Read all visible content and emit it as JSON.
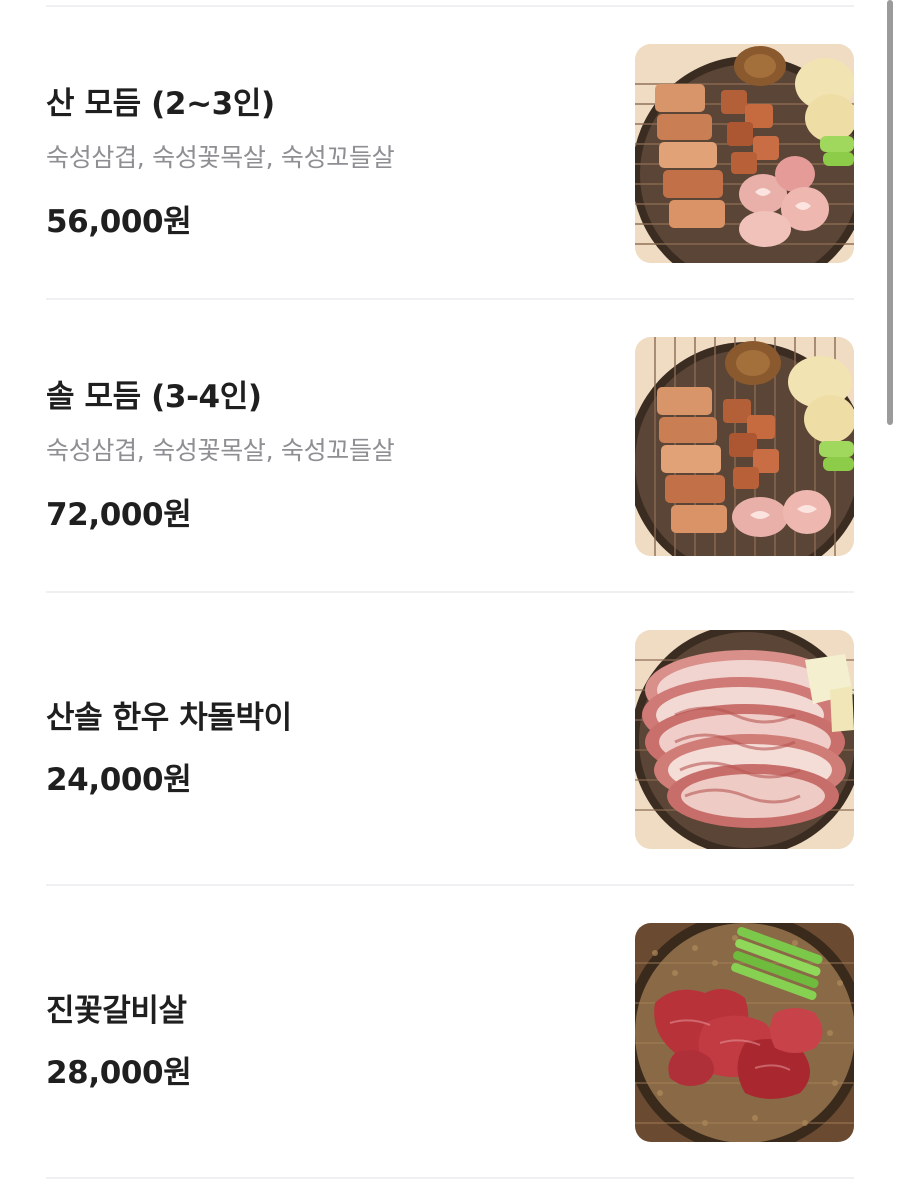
{
  "menu": {
    "items": [
      {
        "name": "산 모듬 (2~3인)",
        "description": "숙성삼겹, 숙성꽃목살, 숙성꼬들살",
        "price": "56,000원",
        "image": "assorted-pork-platter-photo"
      },
      {
        "name": "솔 모듬 (3-4인)",
        "description": "숙성삼겹, 숙성꽃목살, 숙성꼬들살",
        "price": "72,000원",
        "image": "assorted-pork-platter-photo"
      },
      {
        "name": "산솔 한우 차돌박이",
        "price": "24,000원",
        "image": "sliced-brisket-photo"
      },
      {
        "name": "진꽃갈비살",
        "price": "28,000원",
        "image": "beef-rib-finger-photo"
      }
    ]
  }
}
